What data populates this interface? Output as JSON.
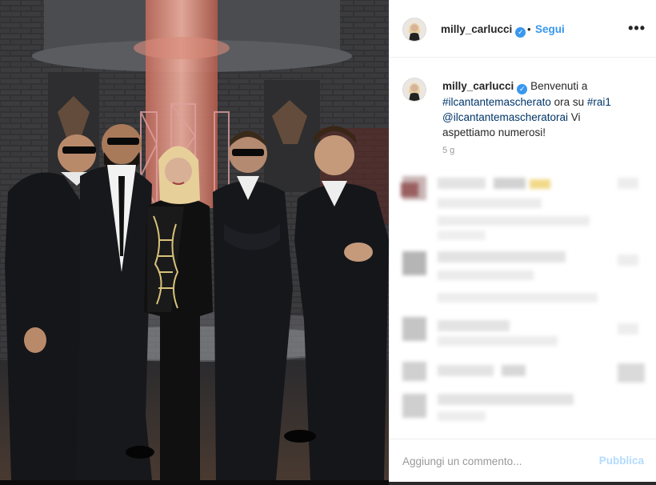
{
  "post": {
    "photo_alt": "photo",
    "header": {
      "username": "milly_carlucci",
      "verified": true,
      "separator": "•",
      "follow_label": "Segui",
      "more_label": "•••"
    },
    "caption": {
      "username": "milly_carlucci",
      "text_1": "Benvenuti a",
      "tag_1": "#ilcantantemascherato",
      "text_2": "ora su",
      "tag_2": "#rai1",
      "mention": "@ilcantantemascheratorai",
      "text_3": "Vi aspettiamo numerosi!",
      "time": "5 g"
    },
    "comment_box": {
      "placeholder": "Aggiungi un commento...",
      "publish_label": "Pubblica"
    }
  },
  "colors": {
    "accent": "#3897f0",
    "hashtag": "#003569",
    "muted": "#999999",
    "publish_disabled": "#b3dbff"
  }
}
